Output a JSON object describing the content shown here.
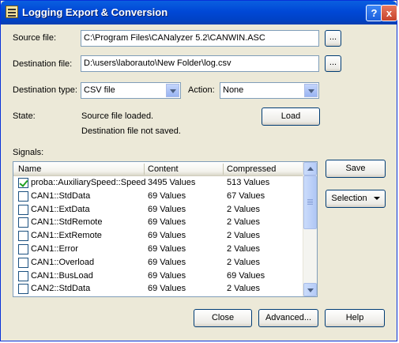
{
  "window": {
    "title": "Logging Export & Conversion",
    "help_label": "?",
    "close_label": "x"
  },
  "source": {
    "label": "Source file:",
    "value": "C:\\Program Files\\CANalyzer 5.2\\CANWIN.ASC",
    "browse_label": "..."
  },
  "destination": {
    "label": "Destination file:",
    "value": "D:\\users\\laborauto\\New Folder\\log.csv",
    "browse_label": "..."
  },
  "dest_type": {
    "label": "Destination type:",
    "value": "CSV file"
  },
  "action": {
    "label": "Action:",
    "value": "None"
  },
  "state": {
    "label": "State:",
    "line1": "Source file loaded.",
    "line2": "Destination file not saved.",
    "load_label": "Load"
  },
  "signals": {
    "label": "Signals:",
    "columns": [
      "Name",
      "Content",
      "Compressed"
    ],
    "rows": [
      {
        "checked": true,
        "name": "proba::AuxiliarySpeed::Speed",
        "content": "3495 Values",
        "compressed": "513 Values"
      },
      {
        "checked": false,
        "name": "CAN1::StdData",
        "content": "69 Values",
        "compressed": "67 Values"
      },
      {
        "checked": false,
        "name": "CAN1::ExtData",
        "content": "69 Values",
        "compressed": "2 Values"
      },
      {
        "checked": false,
        "name": "CAN1::StdRemote",
        "content": "69 Values",
        "compressed": "2 Values"
      },
      {
        "checked": false,
        "name": "CAN1::ExtRemote",
        "content": "69 Values",
        "compressed": "2 Values"
      },
      {
        "checked": false,
        "name": "CAN1::Error",
        "content": "69 Values",
        "compressed": "2 Values"
      },
      {
        "checked": false,
        "name": "CAN1::Overload",
        "content": "69 Values",
        "compressed": "2 Values"
      },
      {
        "checked": false,
        "name": "CAN1::BusLoad",
        "content": "69 Values",
        "compressed": "69 Values"
      },
      {
        "checked": false,
        "name": "CAN2::StdData",
        "content": "69 Values",
        "compressed": "2 Values"
      }
    ]
  },
  "buttons": {
    "save": "Save",
    "selection": "Selection",
    "close": "Close",
    "advanced": "Advanced...",
    "help": "Help"
  }
}
